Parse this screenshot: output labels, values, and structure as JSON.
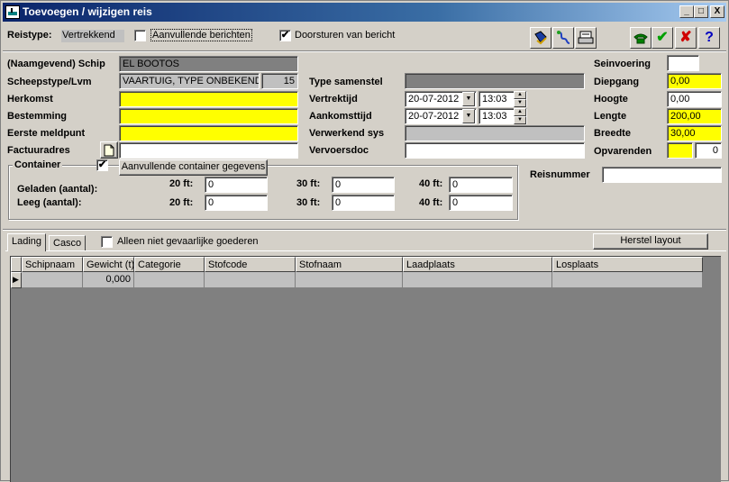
{
  "window": {
    "title": "Toevoegen / wijzigen reis",
    "minimize": "_",
    "maximize": "□",
    "close": "X"
  },
  "top": {
    "reistype_label": "Reistype:",
    "reistype_value": "Vertrekkend",
    "aanvullende_berichten": "Aanvullende berichten",
    "doorsturen_label": "Doorsturen van bericht",
    "doorsturen_checked": "✔"
  },
  "toolbar": {
    "ok_glyph": "✔",
    "cancel_glyph": "✘",
    "help_glyph": "?"
  },
  "left": {
    "schip_label": "(Naamgevend) Schip",
    "schip_value": "EL BOOTOS",
    "scheepstype_label": "Scheepstype/Lvm",
    "scheepstype_value": "VAARTUIG, TYPE ONBEKEND",
    "scheepstype_code": "15",
    "herkomst_label": "Herkomst",
    "herkomst_value": "",
    "bestemming_label": "Bestemming",
    "bestemming_value": "",
    "eerste_meldpunt_label": "Eerste meldpunt",
    "eerste_meldpunt_value": "",
    "factuuradres_label": "Factuuradres",
    "factuuradres_value": ""
  },
  "middle": {
    "type_samenstel_label": "Type samenstel",
    "type_samenstel_value": "",
    "vertrektijd_label": "Vertrektijd",
    "vertrek_date": "20-07-2012",
    "vertrek_time": "13:03",
    "aankomsttijd_label": "Aankomsttijd",
    "aankomst_date": "20-07-2012",
    "aankomst_time": "13:03",
    "verwerkend_sys_label": "Verwerkend sys",
    "verwerkend_sys_value": "",
    "vervoersdoc_label": "Vervoersdoc",
    "vervoersdoc_value": ""
  },
  "right": {
    "seinvoering_label": "Seinvoering",
    "seinvoering_value": "",
    "diepgang_label": "Diepgang",
    "diepgang_value": "0,00",
    "hoogte_label": "Hoogte",
    "hoogte_value": "0,00",
    "lengte_label": "Lengte",
    "lengte_value": "200,00",
    "breedte_label": "Breedte",
    "breedte_value": "30,00",
    "opvarenden_label": "Opvarenden",
    "opvarenden_value": "",
    "opvarenden_count": "0",
    "reisnummer_label": "Reisnummer",
    "reisnummer_value": ""
  },
  "container": {
    "legend": "Container",
    "checked": "✔",
    "aanvullende_button": "Aanvullende container gegevens",
    "geladen_label": "Geladen (aantal):",
    "leeg_label": "Leeg (aantal):",
    "ft20_label": "20 ft:",
    "ft30_label": "30 ft:",
    "ft40_label": "40 ft:",
    "geladen_20": "0",
    "geladen_30": "0",
    "geladen_40": "0",
    "leeg_20": "0",
    "leeg_30": "0",
    "leeg_40": "0"
  },
  "tabs": {
    "lading": "Lading",
    "casco": "Casco"
  },
  "filter": {
    "alleen_label": "Alleen niet gevaarlijke goederen"
  },
  "herstel_button": "Herstel layout",
  "grid": {
    "columns": [
      "Schipnaam",
      "Gewicht (t)",
      "Categorie",
      "Stofcode",
      "Stofnaam",
      "Laadplaats",
      "Losplaats"
    ],
    "rows": [
      [
        "",
        "0,000",
        "",
        "",
        "",
        "",
        ""
      ]
    ],
    "row_indicator": "▶"
  }
}
